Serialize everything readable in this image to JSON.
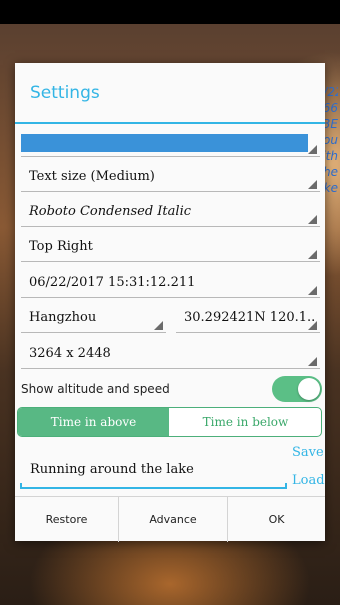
{
  "backdrop": {
    "overlay_lines": [
      "06/22/2017",
      "66",
      "BE",
      "lou",
      "vith",
      "the",
      "ke"
    ]
  },
  "dialog": {
    "title": "Settings",
    "text_size": "Text size (Medium)",
    "font": "Roboto Condensed Italic",
    "position": "Top Right",
    "datetime": "06/22/2017 15:31:12.211",
    "city": "Hangzhou",
    "coordinates": "30.292421N 120.1..",
    "resolution": "3264 x 2448",
    "altitude_label": "Show altitude and speed",
    "altitude_enabled": true,
    "segment": {
      "above_label": "Time in above",
      "below_label": "Time in below",
      "selected": "above"
    },
    "note_value": "Running around the lake",
    "save_label": "Save",
    "load_label": "Load",
    "footer": {
      "restore_label": "Restore",
      "advance_label": "Advance",
      "ok_label": "OK"
    }
  },
  "colors": {
    "accent": "#33b5e5",
    "color_swatch": "#3a92d9",
    "toggle_on": "#5bbf86"
  }
}
